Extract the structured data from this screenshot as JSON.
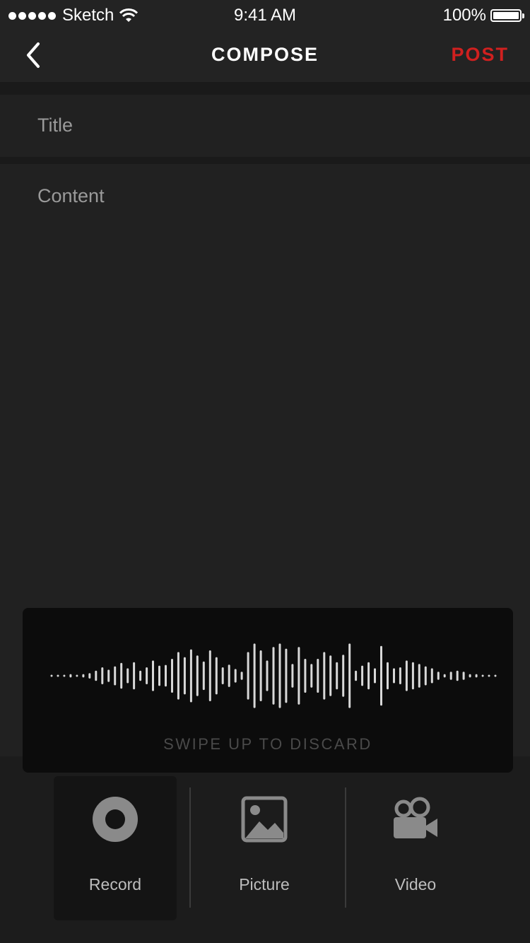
{
  "status_bar": {
    "carrier": "Sketch",
    "time": "9:41 AM",
    "battery": "100%",
    "signal_dots": 5
  },
  "nav": {
    "title": "COMPOSE",
    "action": "POST",
    "action_color": "#d0201f",
    "back_icon": "chevron-left-icon"
  },
  "form": {
    "title_placeholder": "Title",
    "content_placeholder": "Content"
  },
  "recording": {
    "hint": "SWIPE UP TO DISCARD",
    "waveform_amplitudes": [
      0.02,
      0.02,
      0.02,
      0.05,
      0.02,
      0.05,
      0.08,
      0.15,
      0.25,
      0.18,
      0.28,
      0.38,
      0.22,
      0.4,
      0.15,
      0.25,
      0.45,
      0.3,
      0.32,
      0.5,
      0.7,
      0.55,
      0.78,
      0.6,
      0.42,
      0.75,
      0.55,
      0.25,
      0.33,
      0.2,
      0.12,
      0.7,
      0.95,
      0.75,
      0.45,
      0.85,
      0.95,
      0.8,
      0.35,
      0.85,
      0.5,
      0.35,
      0.5,
      0.7,
      0.6,
      0.4,
      0.62,
      0.95,
      0.15,
      0.3,
      0.4,
      0.22,
      0.88,
      0.4,
      0.22,
      0.25,
      0.45,
      0.4,
      0.35,
      0.28,
      0.22,
      0.12,
      0.05,
      0.12,
      0.15,
      0.12,
      0.05,
      0.05,
      0.02,
      0.02,
      0.02
    ]
  },
  "toolbar": {
    "items": [
      {
        "label": "Record",
        "icon": "record-icon"
      },
      {
        "label": "Picture",
        "icon": "picture-icon"
      },
      {
        "label": "Video",
        "icon": "video-camera-icon"
      }
    ],
    "active": "Record"
  }
}
